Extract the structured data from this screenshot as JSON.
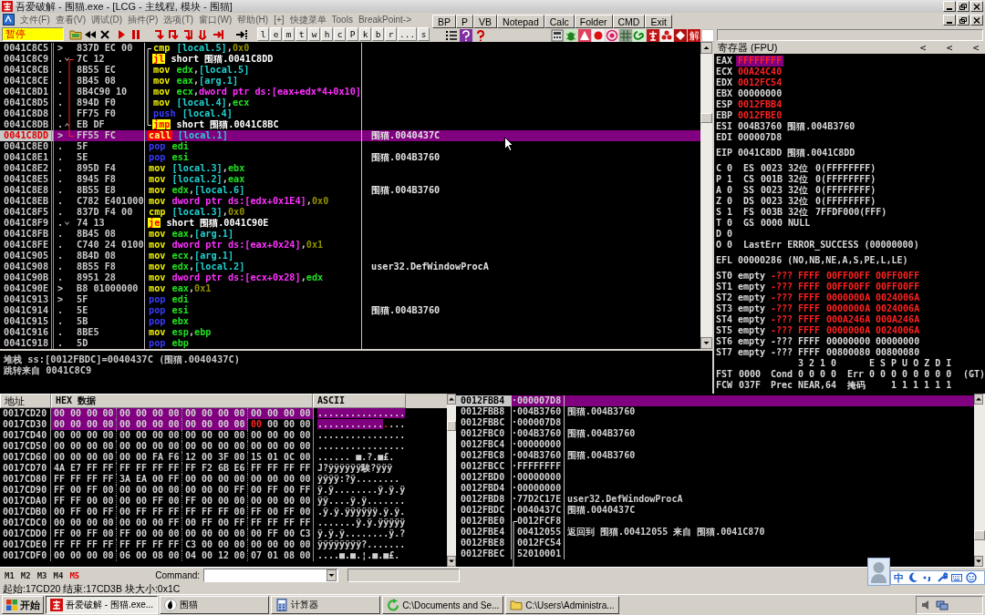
{
  "window": {
    "title": "吾爱破解 - 围猫.exe - [LCG - 主线程, 模块 - 围猫]"
  },
  "menu": [
    "文件(F)",
    "查看(V)",
    "调试(D)",
    "插件(P)",
    "选项(T)",
    "窗口(W)",
    "帮助(H)",
    "[+]",
    "快捷菜单",
    "Tools",
    "BreakPoint->"
  ],
  "quick_buttons": [
    "BP",
    "P",
    "VB",
    "Notepad",
    "Calc",
    "Folder",
    "CMD",
    "Exit"
  ],
  "toolbar": {
    "status": "暂停",
    "letters": [
      "l",
      "e",
      "m",
      "t",
      "w",
      "h",
      "c",
      "P",
      "k",
      "b",
      "r",
      "...",
      "s"
    ],
    "plugin_badge": "解"
  },
  "disassembly": {
    "rows": [
      {
        "address": "0041C8C5",
        "mark": ">",
        "bytes": "837D EC 00",
        "op": "cmp",
        "kind": "compare",
        "args": [
          {
            "text": "[local.5]",
            "kind": "local"
          },
          {
            "text": ",",
            "kind": "punct"
          },
          {
            "text": "0x0",
            "kind": "const"
          }
        ],
        "selected": false,
        "flow": [
          {
            "kind": "loop-start"
          }
        ]
      },
      {
        "address": "0041C8C9",
        "mark": ".",
        "bytes": "7C 12",
        "op": "jl",
        "kind": "jump",
        "args": [
          {
            "text": "short 围猫.0041C8DD",
            "kind": "label"
          }
        ],
        "selected": false,
        "flow": [
          {
            "kind": "arrow-down"
          },
          {
            "kind": "jump-start"
          }
        ]
      },
      {
        "address": "0041C8CB",
        "mark": ".",
        "bytes": "8B55 EC",
        "op": "mov",
        "kind": "move",
        "args": [
          {
            "text": "edx",
            "kind": "reg"
          },
          {
            "text": ",",
            "kind": "punct"
          },
          {
            "text": "[local.5]",
            "kind": "local"
          }
        ],
        "selected": false
      },
      {
        "address": "0041C8CE",
        "mark": ".",
        "bytes": "8B45 08",
        "op": "mov",
        "kind": "move",
        "args": [
          {
            "text": "eax",
            "kind": "reg"
          },
          {
            "text": ",",
            "kind": "punct"
          },
          {
            "text": "[arg.1]",
            "kind": "local"
          }
        ],
        "selected": false
      },
      {
        "address": "0041C8D1",
        "mark": ".",
        "bytes": "8B4C90 10",
        "op": "mov",
        "kind": "move",
        "args": [
          {
            "text": "ecx",
            "kind": "reg"
          },
          {
            "text": ",",
            "kind": "punct"
          },
          {
            "text": "dword ptr ds:[eax+edx*4+0x10]",
            "kind": "mem"
          }
        ],
        "selected": false
      },
      {
        "address": "0041C8D5",
        "mark": ".",
        "bytes": "894D F0",
        "op": "mov",
        "kind": "move",
        "args": [
          {
            "text": "[local.4]",
            "kind": "local"
          },
          {
            "text": ",",
            "kind": "punct"
          },
          {
            "text": "ecx",
            "kind": "reg"
          }
        ],
        "selected": false
      },
      {
        "address": "0041C8D8",
        "mark": ".",
        "bytes": "FF75 F0",
        "op": "push",
        "kind": "stack",
        "args": [
          {
            "text": "[local.4]",
            "kind": "local"
          }
        ],
        "selected": false
      },
      {
        "address": "0041C8DB",
        "mark": ".",
        "bytes": "EB DF",
        "op": "jmp",
        "kind": "jump",
        "args": [
          {
            "text": "short 围猫.0041C8BC",
            "kind": "label"
          }
        ],
        "selected": false,
        "flow": [
          {
            "kind": "arrow-up"
          },
          {
            "kind": "loop-end"
          }
        ]
      },
      {
        "address": "0041C8DD",
        "mark": ">",
        "bytes": "FF55 FC",
        "op": "call",
        "kind": "call",
        "args": [
          {
            "text": "[local.1]",
            "kind": "local"
          }
        ],
        "comment": "围猫.0040437C",
        "selected": true,
        "flow": [
          {
            "kind": "jump-end"
          }
        ]
      },
      {
        "address": "0041C8E0",
        "mark": ".",
        "bytes": "5F",
        "op": "pop",
        "kind": "stack",
        "args": [
          {
            "text": "edi",
            "kind": "reg"
          }
        ],
        "selected": false
      },
      {
        "address": "0041C8E1",
        "mark": ".",
        "bytes": "5E",
        "op": "pop",
        "kind": "stack",
        "args": [
          {
            "text": "esi",
            "kind": "reg"
          }
        ],
        "comment": "围猫.004B3760",
        "selected": false
      },
      {
        "address": "0041C8E2",
        "mark": ".",
        "bytes": "895D F4",
        "op": "mov",
        "kind": "move",
        "args": [
          {
            "text": "[local.3]",
            "kind": "local"
          },
          {
            "text": ",",
            "kind": "punct"
          },
          {
            "text": "ebx",
            "kind": "reg"
          }
        ],
        "selected": false
      },
      {
        "address": "0041C8E5",
        "mark": ".",
        "bytes": "8945 F8",
        "op": "mov",
        "kind": "move",
        "args": [
          {
            "text": "[local.2]",
            "kind": "local"
          },
          {
            "text": ",",
            "kind": "punct"
          },
          {
            "text": "eax",
            "kind": "reg"
          }
        ],
        "selected": false
      },
      {
        "address": "0041C8E8",
        "mark": ".",
        "bytes": "8B55 E8",
        "op": "mov",
        "kind": "move",
        "args": [
          {
            "text": "edx",
            "kind": "reg"
          },
          {
            "text": ",",
            "kind": "punct"
          },
          {
            "text": "[local.6]",
            "kind": "local"
          }
        ],
        "comment": "围猫.004B3760",
        "selected": false
      },
      {
        "address": "0041C8EB",
        "mark": ".",
        "bytes": "C782 E401000",
        "op": "mov",
        "kind": "move",
        "args": [
          {
            "text": "dword ptr ds:[edx+0x1E4]",
            "kind": "mem"
          },
          {
            "text": ",",
            "kind": "punct"
          },
          {
            "text": "0x0",
            "kind": "const"
          }
        ],
        "selected": false
      },
      {
        "address": "0041C8F5",
        "mark": ".",
        "bytes": "837D F4 00",
        "op": "cmp",
        "kind": "compare",
        "args": [
          {
            "text": "[local.3]",
            "kind": "local"
          },
          {
            "text": ",",
            "kind": "punct"
          },
          {
            "text": "0x0",
            "kind": "const"
          }
        ],
        "selected": false
      },
      {
        "address": "0041C8F9",
        "mark": ".",
        "bytes": "74 13",
        "op": "je",
        "kind": "jump",
        "args": [
          {
            "text": "short 围猫.0041C90E",
            "kind": "label"
          }
        ],
        "selected": false,
        "flow": [
          {
            "kind": "arrow-down"
          }
        ]
      },
      {
        "address": "0041C8FB",
        "mark": ".",
        "bytes": "8B45 08",
        "op": "mov",
        "kind": "move",
        "args": [
          {
            "text": "eax",
            "kind": "reg"
          },
          {
            "text": ",",
            "kind": "punct"
          },
          {
            "text": "[arg.1]",
            "kind": "local"
          }
        ],
        "selected": false
      },
      {
        "address": "0041C8FE",
        "mark": ".",
        "bytes": "C740 24 0100",
        "op": "mov",
        "kind": "move",
        "args": [
          {
            "text": "dword ptr ds:[eax+0x24]",
            "kind": "mem"
          },
          {
            "text": ",",
            "kind": "punct"
          },
          {
            "text": "0x1",
            "kind": "const"
          }
        ],
        "selected": false
      },
      {
        "address": "0041C905",
        "mark": ".",
        "bytes": "8B4D 08",
        "op": "mov",
        "kind": "move",
        "args": [
          {
            "text": "ecx",
            "kind": "reg"
          },
          {
            "text": ",",
            "kind": "punct"
          },
          {
            "text": "[arg.1]",
            "kind": "local"
          }
        ],
        "selected": false
      },
      {
        "address": "0041C908",
        "mark": ".",
        "bytes": "8B55 F8",
        "op": "mov",
        "kind": "move",
        "args": [
          {
            "text": "edx",
            "kind": "reg"
          },
          {
            "text": ",",
            "kind": "punct"
          },
          {
            "text": "[local.2]",
            "kind": "local"
          }
        ],
        "comment": "user32.DefWindowProcA",
        "selected": false
      },
      {
        "address": "0041C90B",
        "mark": ".",
        "bytes": "8951 28",
        "op": "mov",
        "kind": "move",
        "args": [
          {
            "text": "dword ptr ds:[ecx+0x28]",
            "kind": "mem"
          },
          {
            "text": ",",
            "kind": "punct"
          },
          {
            "text": "edx",
            "kind": "reg"
          }
        ],
        "selected": false
      },
      {
        "address": "0041C90E",
        "mark": ">",
        "bytes": "B8 01000000",
        "op": "mov",
        "kind": "move",
        "args": [
          {
            "text": "eax",
            "kind": "reg"
          },
          {
            "text": ",",
            "kind": "punct"
          },
          {
            "text": "0x1",
            "kind": "const"
          }
        ],
        "selected": false
      },
      {
        "address": "0041C913",
        "mark": ">",
        "bytes": "5F",
        "op": "pop",
        "kind": "stack",
        "args": [
          {
            "text": "edi",
            "kind": "reg"
          }
        ],
        "selected": false
      },
      {
        "address": "0041C914",
        "mark": ".",
        "bytes": "5E",
        "op": "pop",
        "kind": "stack",
        "args": [
          {
            "text": "esi",
            "kind": "reg"
          }
        ],
        "comment": "围猫.004B3760",
        "selected": false
      },
      {
        "address": "0041C915",
        "mark": ".",
        "bytes": "5B",
        "op": "pop",
        "kind": "stack",
        "args": [
          {
            "text": "ebx",
            "kind": "reg"
          }
        ],
        "selected": false
      },
      {
        "address": "0041C916",
        "mark": ".",
        "bytes": "8BE5",
        "op": "mov",
        "kind": "move",
        "args": [
          {
            "text": "esp",
            "kind": "reg"
          },
          {
            "text": ",",
            "kind": "punct"
          },
          {
            "text": "ebp",
            "kind": "reg"
          }
        ],
        "selected": false
      },
      {
        "address": "0041C918",
        "mark": ".",
        "bytes": "5D",
        "op": "pop",
        "kind": "stack",
        "args": [
          {
            "text": "ebp",
            "kind": "reg"
          }
        ],
        "selected": false
      }
    ]
  },
  "info": [
    "堆栈 ss:[0012FBDC]=0040437C (围猫.0040437C)",
    "跳转来自 0041C8C9"
  ],
  "registers": {
    "title": "寄存器 (FPU)",
    "nav": [
      "<",
      "<",
      "<"
    ],
    "general": [
      {
        "name": "EAX",
        "value": "FFFFFFFF",
        "changed": true,
        "selected": true
      },
      {
        "name": "ECX",
        "value": "00A24C40",
        "changed": true,
        "selected": false
      },
      {
        "name": "EDX",
        "value": "0012FC54",
        "changed": true,
        "selected": false
      },
      {
        "name": "EBX",
        "value": "00000000",
        "changed": false,
        "selected": false
      },
      {
        "name": "ESP",
        "value": "0012FBB4",
        "changed": true,
        "selected": false
      },
      {
        "name": "EBP",
        "value": "0012FBE0",
        "changed": true,
        "selected": false
      },
      {
        "name": "ESI",
        "value": "004B3760",
        "changed": false,
        "selected": false,
        "comment": "围猫.004B3760"
      },
      {
        "name": "EDI",
        "value": "000007D8",
        "changed": false,
        "selected": false
      }
    ],
    "eip": {
      "name": "EIP",
      "value": "0041C8DD",
      "changed": false,
      "selected": false,
      "comment": "围猫.0041C8DD"
    },
    "flags": [
      {
        "flag": "C",
        "bit": "0",
        "parts": [
          "ES",
          "0023",
          "32位",
          "0(FFFFFFFF)"
        ]
      },
      {
        "flag": "P",
        "bit": "1",
        "parts": [
          "CS",
          "001B",
          "32位",
          "0(FFFFFFFF)"
        ]
      },
      {
        "flag": "A",
        "bit": "0",
        "parts": [
          "SS",
          "0023",
          "32位",
          "0(FFFFFFFF)"
        ]
      },
      {
        "flag": "Z",
        "bit": "0",
        "parts": [
          "DS",
          "0023",
          "32位",
          "0(FFFFFFFF)"
        ]
      },
      {
        "flag": "S",
        "bit": "1",
        "parts": [
          "FS",
          "003B",
          "32位",
          "7FFDF000(FFF)"
        ]
      },
      {
        "flag": "T",
        "bit": "0",
        "parts": [
          "GS",
          "0000",
          "NULL"
        ]
      },
      {
        "flag": "D",
        "bit": "0"
      },
      {
        "flag": "O",
        "bit": "0",
        "parts": [
          "LastErr",
          "ERROR_SUCCESS (00000000)"
        ]
      }
    ],
    "efl": {
      "name": "EFL",
      "value": "00000286",
      "comment": "(NO,NB,NE,A,S,PE,L,LE)"
    },
    "fpu": [
      {
        "name": "ST0",
        "tag": "empty",
        "sign": "-???",
        "exp": "FFFF",
        "hi": "00FF00FF",
        "lo": "00FF00FF",
        "changed": true
      },
      {
        "name": "ST1",
        "tag": "empty",
        "sign": "-???",
        "exp": "FFFF",
        "hi": "00FF00FF",
        "lo": "00FF00FF",
        "changed": true
      },
      {
        "name": "ST2",
        "tag": "empty",
        "sign": "-???",
        "exp": "FFFF",
        "hi": "0000000A",
        "lo": "0024006A",
        "changed": true
      },
      {
        "name": "ST3",
        "tag": "empty",
        "sign": "-???",
        "exp": "FFFF",
        "hi": "0000000A",
        "lo": "0024006A",
        "changed": true
      },
      {
        "name": "ST4",
        "tag": "empty",
        "sign": "-???",
        "exp": "FFFF",
        "hi": "000A246A",
        "lo": "000A246A",
        "changed": true
      },
      {
        "name": "ST5",
        "tag": "empty",
        "sign": "-???",
        "exp": "FFFF",
        "hi": "0000000A",
        "lo": "0024006A",
        "changed": true
      },
      {
        "name": "ST6",
        "tag": "empty",
        "sign": "-???",
        "exp": "FFFF",
        "hi": "00000000",
        "lo": "00000000",
        "changed": false
      },
      {
        "name": "ST7",
        "tag": "empty",
        "sign": "-???",
        "exp": "FFFF",
        "hi": "00800080",
        "lo": "00800080",
        "changed": false
      }
    ],
    "fpu_status": {
      "cond_bits": "3 2 1 0",
      "err_bits": "E S P U O Z D I",
      "fst": [
        "FST",
        "0000",
        "Cond",
        "0 0 0 0",
        "Err",
        "0 0 0 0 0 0 0 0",
        "(GT)"
      ],
      "fcw": [
        "FCW",
        "037F",
        "Prec",
        "NEAR,64",
        "掩码",
        "1 1 1 1 1 1"
      ]
    }
  },
  "dump": {
    "headers": [
      "地址",
      "HEX 数据",
      "ASCII"
    ],
    "rows": [
      {
        "address": "0017CD20",
        "hex": [
          {
            "bytes": [
              "00",
              "00",
              "00",
              "00",
              "00",
              "00",
              "00",
              "00",
              "00",
              "00",
              "00",
              "00",
              "00",
              "00",
              "00",
              "00"
            ],
            "selected": true,
            "changed": false
          }
        ],
        "ascii": [
          {
            "text": "................",
            "selected": true,
            "changed": false
          }
        ]
      },
      {
        "address": "0017CD30",
        "hex": [
          {
            "bytes": [
              "00",
              "00",
              "00",
              "00",
              "00",
              "00",
              "00",
              "00",
              "00",
              "00",
              "00",
              "00"
            ],
            "selected": true,
            "changed": false
          },
          {
            "bytes": [
              "00"
            ],
            "selected": false,
            "changed": true
          },
          {
            "bytes": [
              "00",
              "00",
              "00"
            ],
            "selected": false,
            "changed": false
          }
        ],
        "ascii": [
          {
            "text": "............",
            "selected": true,
            "changed": false
          },
          {
            "text": ".",
            "selected": false,
            "changed": true
          },
          {
            "text": "...",
            "selected": false,
            "changed": false
          }
        ]
      },
      {
        "address": "0017CD40",
        "hex": [
          {
            "bytes": [
              "00",
              "00",
              "00",
              "00",
              "00",
              "00",
              "00",
              "00",
              "00",
              "00",
              "00",
              "00",
              "00",
              "00",
              "00",
              "00"
            ],
            "selected": false,
            "changed": false
          }
        ],
        "ascii": [
          {
            "text": "................",
            "selected": false,
            "changed": false
          }
        ]
      },
      {
        "address": "0017CD50",
        "hex": [
          {
            "bytes": [
              "00",
              "00",
              "00",
              "00",
              "00",
              "00",
              "00",
              "00",
              "00",
              "00",
              "00",
              "00",
              "00",
              "00",
              "00",
              "00"
            ],
            "selected": false,
            "changed": false
          }
        ],
        "ascii": [
          {
            "text": "................",
            "selected": false,
            "changed": false
          }
        ]
      },
      {
        "address": "0017CD60",
        "hex": [
          {
            "bytes": [
              "00",
              "00",
              "00",
              "00",
              "00",
              "00",
              "FA",
              "F6",
              "12",
              "00",
              "3F",
              "00",
              "15",
              "01",
              "0C",
              "00"
            ],
            "selected": false,
            "changed": false
          }
        ],
        "ascii": [
          {
            "text": "......  ■.?.■£.",
            "selected": false,
            "changed": false
          }
        ]
      },
      {
        "address": "0017CD70",
        "hex": [
          {
            "bytes": [
              "4A",
              "E7",
              "FF",
              "FF",
              "FF",
              "FF",
              "FF",
              "FF",
              "FF",
              "F2",
              "6B",
              "E6",
              "FF",
              "FF",
              "FF",
              "FF"
            ],
            "selected": false,
            "changed": false
          }
        ],
        "ascii": [
          {
            "text": "J?ÿÿÿÿÿÿ騃?ÿÿÿ",
            "selected": false,
            "changed": false
          }
        ]
      },
      {
        "address": "0017CD80",
        "hex": [
          {
            "bytes": [
              "FF",
              "FF",
              "FF",
              "FF",
              "3A",
              "EA",
              "00",
              "FF",
              "00",
              "00",
              "00",
              "00",
              "00",
              "00",
              "00",
              "00"
            ],
            "selected": false,
            "changed": false
          }
        ],
        "ascii": [
          {
            "text": "ÿÿÿÿ:?ÿ........",
            "selected": false,
            "changed": false
          }
        ]
      },
      {
        "address": "0017CD90",
        "hex": [
          {
            "bytes": [
              "FF",
              "00",
              "FF",
              "00",
              "00",
              "00",
              "00",
              "00",
              "00",
              "00",
              "00",
              "FF",
              "00",
              "FF",
              "00",
              "FF"
            ],
            "selected": false,
            "changed": false
          }
        ],
        "ascii": [
          {
            "text": "ÿ.ÿ........ÿ.ÿ.ÿ",
            "selected": false,
            "changed": false
          }
        ]
      },
      {
        "address": "0017CDA0",
        "hex": [
          {
            "bytes": [
              "FF",
              "FF",
              "00",
              "00",
              "00",
              "00",
              "FF",
              "00",
              "FF",
              "00",
              "00",
              "00",
              "00",
              "00",
              "00",
              "00"
            ],
            "selected": false,
            "changed": false
          }
        ],
        "ascii": [
          {
            "text": "ÿÿ....ÿ.ÿ.......",
            "selected": false,
            "changed": false
          }
        ]
      },
      {
        "address": "0017CDB0",
        "hex": [
          {
            "bytes": [
              "00",
              "FF",
              "00",
              "FF",
              "00",
              "FF",
              "FF",
              "FF",
              "FF",
              "FF",
              "FF",
              "00",
              "FF",
              "00",
              "FF",
              "00"
            ],
            "selected": false,
            "changed": false
          }
        ],
        "ascii": [
          {
            "text": ".ÿ.ÿ.ÿÿÿÿÿÿ.ÿ.ÿ.",
            "selected": false,
            "changed": false
          }
        ]
      },
      {
        "address": "0017CDC0",
        "hex": [
          {
            "bytes": [
              "00",
              "00",
              "00",
              "00",
              "00",
              "00",
              "00",
              "FF",
              "00",
              "FF",
              "00",
              "FF",
              "FF",
              "FF",
              "FF",
              "FF"
            ],
            "selected": false,
            "changed": false
          }
        ],
        "ascii": [
          {
            "text": ".......ÿ.ÿ.ÿÿÿÿÿ",
            "selected": false,
            "changed": false
          }
        ]
      },
      {
        "address": "0017CDD0",
        "hex": [
          {
            "bytes": [
              "FF",
              "00",
              "FF",
              "00",
              "FF",
              "00",
              "00",
              "00",
              "00",
              "00",
              "00",
              "00",
              "00",
              "FF",
              "00",
              "C3"
            ],
            "selected": false,
            "changed": false
          }
        ],
        "ascii": [
          {
            "text": "ÿ.ÿ.ÿ........ÿ.?",
            "selected": false,
            "changed": false
          }
        ]
      },
      {
        "address": "0017CDE0",
        "hex": [
          {
            "bytes": [
              "FF",
              "FF",
              "FF",
              "FF",
              "FF",
              "FF",
              "FF",
              "FF",
              "C3",
              "00",
              "00",
              "00",
              "00",
              "00",
              "00",
              "00"
            ],
            "selected": false,
            "changed": false
          }
        ],
        "ascii": [
          {
            "text": "ÿÿÿÿÿÿÿÿ?.......",
            "selected": false,
            "changed": false
          }
        ]
      },
      {
        "address": "0017CDF0",
        "hex": [
          {
            "bytes": [
              "00",
              "00",
              "00",
              "00",
              "06",
              "00",
              "08",
              "00",
              "04",
              "00",
              "12",
              "00",
              "07",
              "01",
              "08",
              "00"
            ],
            "selected": false,
            "changed": false
          }
        ],
        "ascii": [
          {
            "text": "....■.■.¦.■.■£.",
            "selected": false,
            "changed": false
          }
        ]
      }
    ]
  },
  "stack": {
    "rows": [
      {
        "address": "0012FBB4",
        "mark": "·",
        "value": "000007D8",
        "selected": true
      },
      {
        "address": "0012FBB8",
        "mark": "·",
        "value": "004B3760",
        "comment": "围猫.004B3760",
        "selected": false
      },
      {
        "address": "0012FBBC",
        "mark": "·",
        "value": "000007D8",
        "selected": false
      },
      {
        "address": "0012FBC0",
        "mark": "·",
        "value": "004B3760",
        "comment": "围猫.004B3760",
        "selected": false
      },
      {
        "address": "0012FBC4",
        "mark": "·",
        "value": "00000000",
        "selected": false
      },
      {
        "address": "0012FBC8",
        "mark": "·",
        "value": "004B3760",
        "comment": "围猫.004B3760",
        "selected": false
      },
      {
        "address": "0012FBCC",
        "mark": "·",
        "value": "FFFFFFFF",
        "selected": false
      },
      {
        "address": "0012FBD0",
        "mark": "·",
        "value": "00000000",
        "selected": false
      },
      {
        "address": "0012FBD4",
        "mark": "·",
        "value": "00000000",
        "selected": false
      },
      {
        "address": "0012FBD8",
        "mark": "·",
        "value": "77D2C17E",
        "comment": "user32.DefWindowProcA",
        "selected": false
      },
      {
        "address": "0012FBDC",
        "mark": "·",
        "value": "0040437C",
        "comment": "围猫.0040437C",
        "selected": false
      },
      {
        "address": "0012FBE0",
        "value": "0012FCF8",
        "flow": [
          {
            "kind": "frame-start"
          }
        ],
        "selected": false
      },
      {
        "address": "0012FBE4",
        "value": "00412055",
        "comment": "返回到 围猫.00412055 来自 围猫.0041C870",
        "selected": false
      },
      {
        "address": "0012FBE8",
        "value": "0012FC54",
        "selected": false
      },
      {
        "address": "0012FBEC",
        "value": "52010001",
        "selected": false
      }
    ]
  },
  "memory_tabs": [
    {
      "label": "M1",
      "selected": false
    },
    {
      "label": "M2",
      "selected": false
    },
    {
      "label": "M3",
      "selected": false
    },
    {
      "label": "M4",
      "selected": false
    },
    {
      "label": "M5",
      "selected": true
    }
  ],
  "command": {
    "label": "Command:"
  },
  "status_bar": "起始:17CD20 结束:17CD3B 块大小:0x1C",
  "taskbar": {
    "start": "开始",
    "tasks": [
      {
        "label": "吾爱破解 - 围猫.exe...",
        "selected": true
      },
      {
        "label": "围猫",
        "selected": false
      },
      {
        "label": "计算器",
        "selected": false
      },
      {
        "label": "C:\\Documents and Se...",
        "selected": false
      },
      {
        "label": "C:\\Users\\Administra...",
        "selected": false
      }
    ]
  },
  "ime": {
    "mode": "中"
  }
}
